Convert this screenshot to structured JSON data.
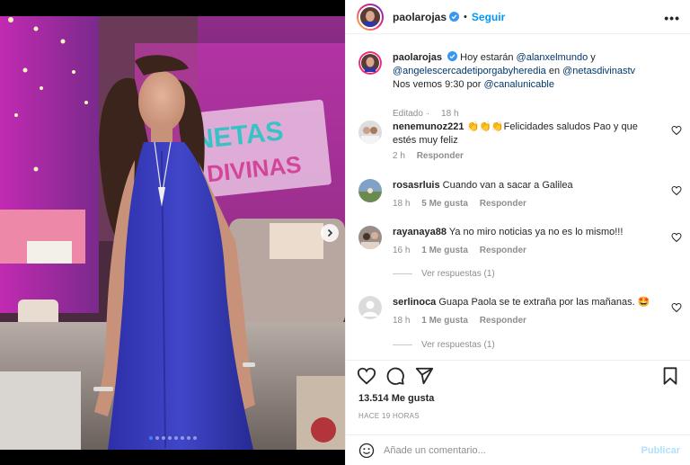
{
  "post": {
    "author": "paolarojas",
    "separator": "•",
    "follow_label": "Seguir",
    "more_label": "•••"
  },
  "caption": {
    "author": "paolarojas",
    "part1": "Hoy estarán ",
    "mention1": "@alanxelmundo",
    "part2": " y",
    "mention2": "@angelescercadetiporgabyheredia",
    "part3": " en ",
    "mention3": "@netasdivinastv",
    "part4": "Nos vemos 9:30 por ",
    "mention4": "@canalunicable",
    "edited": "Editado",
    "time": "18 h"
  },
  "photo": {
    "sign_line1": "NETAS",
    "sign_line2": "DIVINAS",
    "accent": "#3b82f6"
  },
  "comments": [
    {
      "user": "nenemunoz221",
      "text": "👏👏👏Felicidades saludos Pao y que estés muy feliz",
      "time": "2 h",
      "likes": "",
      "reply": "Responder",
      "replies": ""
    },
    {
      "user": "rosasrluis",
      "text": "Cuando van a sacar a Galilea",
      "time": "18 h",
      "likes": "5 Me gusta",
      "reply": "Responder",
      "replies": ""
    },
    {
      "user": "rayanaya88",
      "text": "Ya no miro noticias ya no es lo mismo!!!",
      "time": "16 h",
      "likes": "1 Me gusta",
      "reply": "Responder",
      "replies": "Ver respuestas (1)"
    },
    {
      "user": "serlinoca",
      "text": "Guapa Paola se te extraña por las mañanas. 🤩",
      "time": "18 h",
      "likes": "1 Me gusta",
      "reply": "Responder",
      "replies": "Ver respuestas (1)"
    }
  ],
  "stats": {
    "likes": "13.514 Me gusta",
    "ago": "HACE 19 HORAS"
  },
  "composer": {
    "placeholder": "Añade un comentario...",
    "publish": "Publicar"
  },
  "carousel": {
    "dot_count": 8,
    "active_index": 0
  },
  "icons": {
    "verified": "verified-badge-icon",
    "like": "heart-icon",
    "comment": "comment-icon",
    "share": "send-icon",
    "save": "bookmark-icon",
    "emoji": "emoji-icon",
    "next": "chevron-right-icon",
    "more": "more-options-icon"
  },
  "colors": {
    "link": "#00376b",
    "follow": "#0095f6",
    "verified": "#3897f0",
    "publish_disabled": "#b2dffc"
  }
}
